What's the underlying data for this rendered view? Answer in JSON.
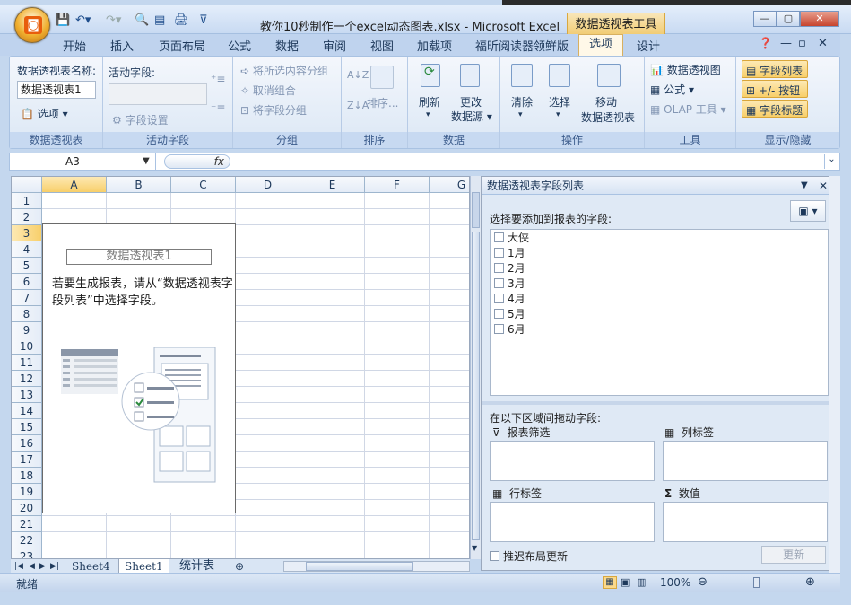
{
  "window": {
    "doc_title": "教你10秒制作一个excel动态图表.xlsx - Microsoft Excel",
    "context_tab": "数据透视表工具",
    "min": "—",
    "max": "▢",
    "close": "✕"
  },
  "tabs": [
    "开始",
    "插入",
    "页面布局",
    "公式",
    "数据",
    "审阅",
    "视图",
    "加载项",
    "福昕阅读器领鲜版",
    "选项",
    "设计"
  ],
  "selected_tab": "选项",
  "ribbon": {
    "g1": {
      "name_label": "数据透视表名称:",
      "name_value": "数据透视表1",
      "options": "选项",
      "caption": "数据透视表"
    },
    "g2": {
      "field_label": "活动字段:",
      "settings": "字段设置",
      "caption": "活动字段"
    },
    "g3": {
      "group_sel": "将所选内容分组",
      "ungroup": "取消组合",
      "group_field": "将字段分组",
      "caption": "分组"
    },
    "g4": {
      "sort": "排序...",
      "caption": "排序",
      "az": "A↓Z",
      "za": "Z↓A"
    },
    "g5": {
      "refresh": "刷新",
      "change_src1": "更改",
      "change_src2": "数据源",
      "caption": "数据"
    },
    "g6": {
      "clear": "清除",
      "select": "选择",
      "move1": "移动",
      "move2": "数据透视表",
      "caption": "操作"
    },
    "g7": {
      "pivotchart": "数据透视图",
      "formula": "公式",
      "olap": "OLAP 工具",
      "caption": "工具"
    },
    "g8": {
      "field_list": "字段列表",
      "buttons": "+/- 按钮",
      "headers": "字段标题",
      "caption": "显示/隐藏"
    }
  },
  "formula_bar": {
    "name_box": "A3",
    "fx": "fx",
    "value": ""
  },
  "grid": {
    "columns": [
      "A",
      "B",
      "C",
      "D",
      "E",
      "F",
      "G"
    ],
    "rows": [
      "1",
      "2",
      "3",
      "4",
      "5",
      "6",
      "7",
      "8",
      "9",
      "10",
      "11",
      "12",
      "13",
      "14",
      "15",
      "16",
      "17",
      "18",
      "19",
      "20",
      "21",
      "22",
      "23"
    ],
    "pivot_title": "数据透视表1",
    "pivot_msg": "若要生成报表，请从“数据透视表字段列表”中选择字段。"
  },
  "sheets": [
    "Sheet4",
    "Sheet1",
    "统计表"
  ],
  "active_sheet": "Sheet1",
  "status": {
    "ready": "就绪",
    "zoom": "100%"
  },
  "field_pane": {
    "title": "数据透视表字段列表",
    "choose_label": "选择要添加到报表的字段:",
    "fields": [
      "大侠",
      "1月",
      "2月",
      "3月",
      "4月",
      "5月",
      "6月"
    ],
    "drag_label": "在以下区域间拖动字段:",
    "report_filter": "报表筛选",
    "column_labels": "列标签",
    "row_labels": "行标签",
    "values": "数值",
    "defer": "推迟布局更新",
    "update": "更新"
  }
}
